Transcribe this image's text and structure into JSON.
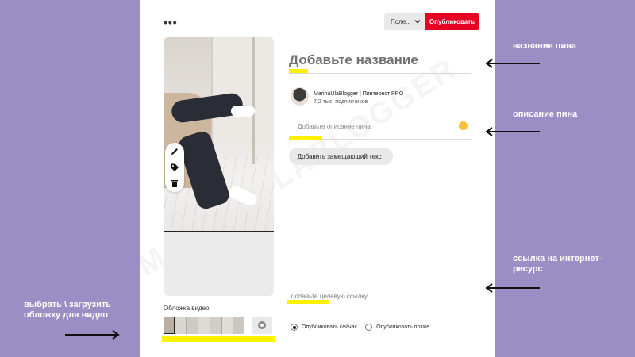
{
  "toolbar": {
    "more_icon": "•••",
    "board_select": "Поле...",
    "publish_label": "Опубликовать"
  },
  "media": {
    "cover_label": "Обложка видео",
    "tools": [
      "edit-icon",
      "tag-icon",
      "trash-icon"
    ]
  },
  "form": {
    "title_placeholder": "Добавьте название",
    "user_name": "MarinaUlaBlogger | Пинтерест PRO",
    "user_followers": "7,2 тыс. подписчиков",
    "description_placeholder": "Добавьте описание пина",
    "alt_text_button": "Добавить замещающий текст",
    "link_placeholder": "Добавьте целевую ссылку",
    "publish_options": [
      "Опубликовать сейчас",
      "Опубликовать позже"
    ],
    "publish_selected": "Опубликовать сейчас"
  },
  "annotations": {
    "title": "название пина",
    "description": "описание пина",
    "link": "ссылка на интернет-ресурс",
    "cover": "выбрать \\ загрузить обложку для видео"
  },
  "watermark": "MARINAULABLOGGER",
  "colors": {
    "background": "#9b8ec4",
    "publish": "#e60023",
    "highlight": "#fff200"
  }
}
